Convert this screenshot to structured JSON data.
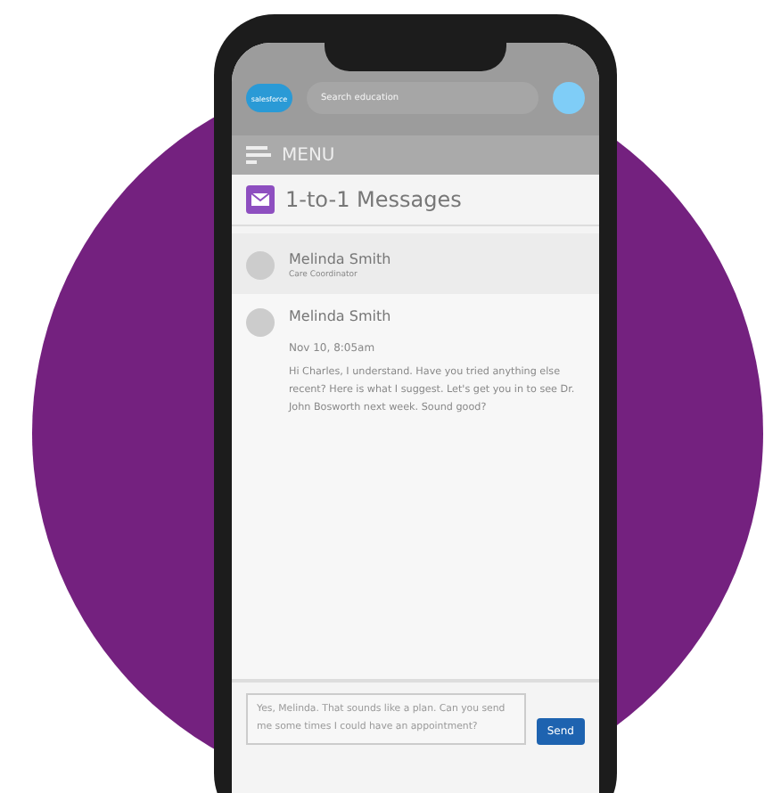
{
  "header": {
    "logo": "salesforce",
    "search": {
      "placeholder": "Search education"
    }
  },
  "menu": {
    "label": "MENU"
  },
  "title": "1-to-1 Messages",
  "contact": {
    "name": "Melinda Smith",
    "role": "Care Coordinator"
  },
  "messages": [
    {
      "sender": "Melinda Smith",
      "time": "Nov 10, 8:05am",
      "text": "Hi Charles, I understand. Have you tried anything else recent? Here is what I suggest. Let's get you in to see Dr. John Bosworth next week. Sound good?"
    }
  ],
  "compose": {
    "value": "Yes, Melinda. That sounds like a plan. Can you send me some times I could have an appointment?",
    "button": "Send"
  }
}
